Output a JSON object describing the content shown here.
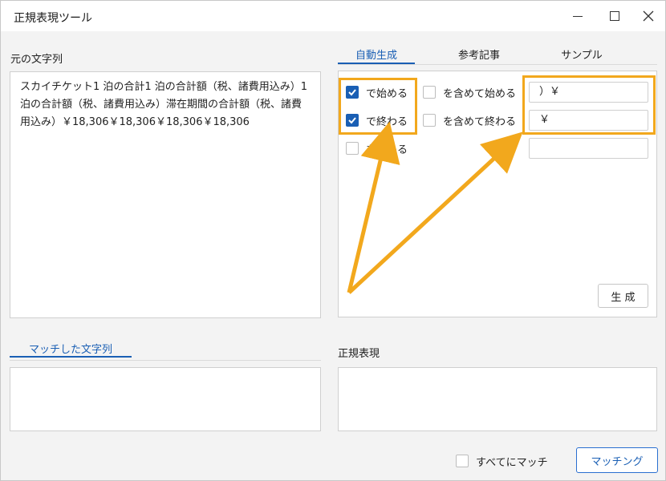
{
  "window": {
    "title": "正規表現ツール"
  },
  "source": {
    "label": "元の文字列",
    "text": "スカイチケット1 泊の合計1 泊の合計額（税、諸費用込み）1 泊の合計額（税、諸費用込み）滞在期間の合計額（税、諸費用込み）￥18,306￥18,306￥18,306￥18,306"
  },
  "tabs": [
    {
      "label": "自動生成",
      "active": true
    },
    {
      "label": "参考記事",
      "active": false
    },
    {
      "label": "サンプル",
      "active": false
    }
  ],
  "options": {
    "starts_with": {
      "label": "で始める",
      "checked": true
    },
    "ends_with": {
      "label": "で終わる",
      "checked": true
    },
    "contains": {
      "label": "を含める",
      "checked": false
    },
    "include_starts": {
      "label": "を含めて始める",
      "checked": false
    },
    "include_ends": {
      "label": "を含めて終わる",
      "checked": false
    },
    "starts_value": "）￥",
    "ends_value": "￥",
    "contains_value": ""
  },
  "generate_button": "生 成",
  "matched": {
    "label": "マッチした文字列"
  },
  "regex": {
    "label": "正規表現"
  },
  "match_all": {
    "label": "すべてにマッチ",
    "checked": false
  },
  "match_button": "マッチング",
  "colors": {
    "accent": "#1a5fb4",
    "highlight": "#f2a81d"
  }
}
